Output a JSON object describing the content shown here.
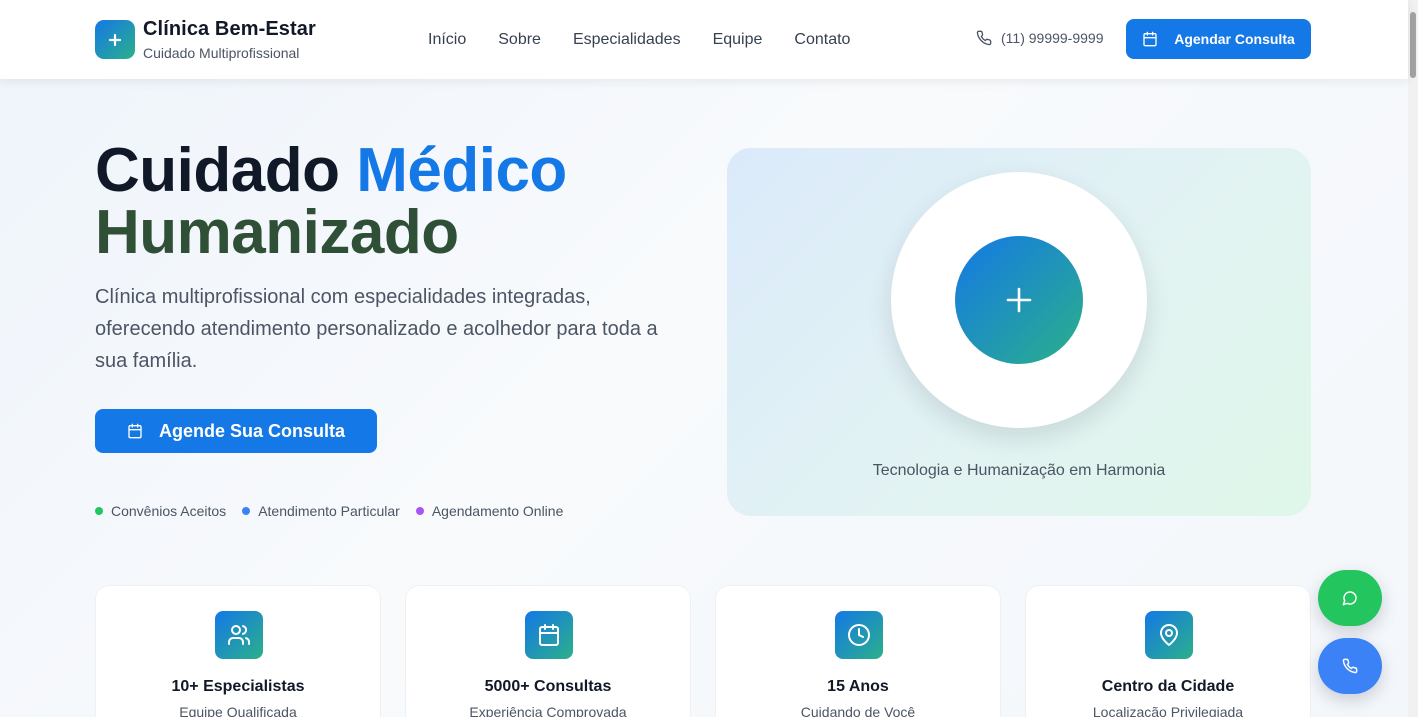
{
  "header": {
    "brand": {
      "name": "Clínica Bem-Estar",
      "subtitle": "Cuidado Multiprofissional",
      "icon": "plus-icon"
    },
    "nav": [
      {
        "label": "Início"
      },
      {
        "label": "Sobre"
      },
      {
        "label": "Especialidades"
      },
      {
        "label": "Equipe"
      },
      {
        "label": "Contato"
      }
    ],
    "phone": {
      "number": "(11) 99999-9999",
      "icon": "phone-icon"
    },
    "cta": {
      "label": "Agendar Consulta",
      "icon": "calendar-icon"
    }
  },
  "hero": {
    "title_part1": "Cuidado",
    "title_accent": "Médico",
    "title_part2": "Humanizado",
    "description": "Clínica multiprofissional com especialidades integradas, oferecendo atendimento personalizado e acolhedor para toda a sua família.",
    "cta": {
      "label": "Agende Sua Consulta",
      "icon": "calendar-icon"
    },
    "tags": [
      {
        "label": "Convênios Aceitos",
        "color": "#22c55e"
      },
      {
        "label": "Atendimento Particular",
        "color": "#3b82f6"
      },
      {
        "label": "Agendamento Online",
        "color": "#a855f7"
      }
    ],
    "visual": {
      "caption": "Tecnologia e Humanização em Harmonia",
      "icon": "plus-icon"
    }
  },
  "stats": [
    {
      "title": "10+ Especialistas",
      "subtitle": "Equipe Qualificada",
      "icon": "users-icon"
    },
    {
      "title": "5000+ Consultas",
      "subtitle": "Experiência Comprovada",
      "icon": "calendar-icon"
    },
    {
      "title": "15 Anos",
      "subtitle": "Cuidando de Você",
      "icon": "clock-icon"
    },
    {
      "title": "Centro da Cidade",
      "subtitle": "Localização Privilegiada",
      "icon": "map-pin-icon"
    }
  ],
  "floating": {
    "whatsapp": {
      "icon": "chat-icon",
      "color": "#22c55e"
    },
    "call": {
      "icon": "phone-icon",
      "color": "#3b82f6"
    }
  },
  "colors": {
    "primary": "#1478e6",
    "secondary": "#2bb08a",
    "title_dark": "#2f4f36"
  }
}
